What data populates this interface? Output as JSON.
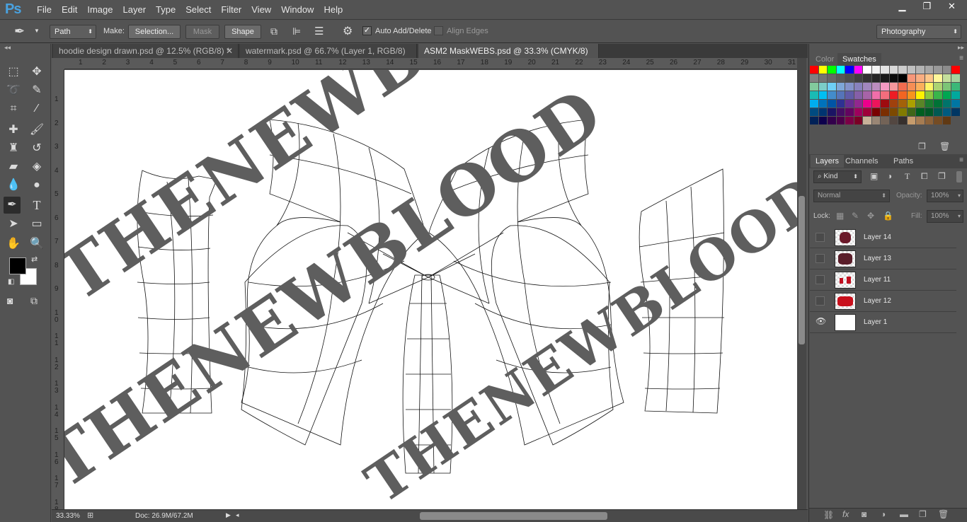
{
  "app": {
    "logo": "Ps",
    "workspace": "Photography",
    "window_buttons": [
      "▁",
      "❐",
      "✕"
    ]
  },
  "menu": [
    "File",
    "Edit",
    "Image",
    "Layer",
    "Type",
    "Select",
    "Filter",
    "View",
    "Window",
    "Help"
  ],
  "options": {
    "mode": "Path",
    "make_label": "Make:",
    "selection_btn": "Selection...",
    "mask_btn": "Mask",
    "shape_btn": "Shape",
    "auto_add_delete": "Auto Add/Delete",
    "auto_add_checked": true,
    "align_edges": "Align Edges"
  },
  "tabs": [
    {
      "label": "hoodie design drawn.psd @ 12.5% (RGB/8) *",
      "active": false
    },
    {
      "label": "watermark.psd @ 66.7% (Layer 1, RGB/8) *",
      "active": false
    },
    {
      "label": "ASM2 MaskWEBS.psd @ 33.3% (CMYK/8) *",
      "active": true
    }
  ],
  "ruler_top": [
    "1",
    "2",
    "3",
    "4",
    "5",
    "6",
    "7",
    "8",
    "9",
    "10",
    "11",
    "12",
    "13",
    "14",
    "15",
    "16",
    "17",
    "18",
    "19",
    "20",
    "21",
    "22",
    "23",
    "24",
    "25",
    "26",
    "27",
    "28",
    "29",
    "30",
    "31"
  ],
  "ruler_left": [
    "1",
    "2",
    "3",
    "4",
    "5",
    "6",
    "7",
    "8",
    "9",
    "1 0",
    "1 1",
    "1 2",
    "1 3",
    "1 4",
    "1 5",
    "1 6",
    "1 7",
    "1 8"
  ],
  "watermark": "THENEWBLOOD",
  "status": {
    "zoom": "33.33%",
    "doc": "Doc: 26.9M/67.2M"
  },
  "panels": {
    "top_tabs": [
      "Color",
      "Swatches"
    ],
    "active_top": "Swatches",
    "layers_tabs": [
      "Layers",
      "Channels",
      "Paths"
    ],
    "filter_kind": "Kind",
    "blend_mode": "Normal",
    "opacity_label": "Opacity:",
    "opacity_value": "100%",
    "lock_label": "Lock:",
    "fill_label": "Fill:",
    "fill_value": "100%"
  },
  "layers": [
    {
      "name": "Layer 14",
      "visible": false,
      "thumb": "spider"
    },
    {
      "name": "Layer 13",
      "visible": false,
      "thumb": "spider"
    },
    {
      "name": "Layer 11",
      "visible": false,
      "thumb": "red-sparse"
    },
    {
      "name": "Layer 12",
      "visible": false,
      "thumb": "red"
    },
    {
      "name": "Layer 1",
      "visible": true,
      "thumb": "white"
    }
  ],
  "swatches": [
    "#ff0000",
    "#ffff00",
    "#00ff00",
    "#00ffff",
    "#0000ff",
    "#ff00ff",
    "#ffffff",
    "#f2f2f2",
    "#e5e5e5",
    "#d9d9d9",
    "#cccccc",
    "#bfbfbf",
    "#b3b3b3",
    "#a6a6a6",
    "#999999",
    "#8c8c8c",
    "#ff0000",
    "#808080",
    "#737373",
    "#666666",
    "#595959",
    "#4d4d4d",
    "#404040",
    "#333333",
    "#262626",
    "#1a1a1a",
    "#0d0d0d",
    "#000000",
    "#f69679",
    "#f9ad81",
    "#fdc68a",
    "#fff79a",
    "#c4df9b",
    "#a3d39c",
    "#82ca9d",
    "#7bcdc8",
    "#6ecff6",
    "#7ea7d8",
    "#8493ca",
    "#8882be",
    "#a187be",
    "#bc8dbf",
    "#f49ac2",
    "#f6989d",
    "#f26c4f",
    "#f68e55",
    "#fbaf5c",
    "#fff467",
    "#acd372",
    "#7cc576",
    "#3bb878",
    "#1abbb4",
    "#00bff3",
    "#438ccb",
    "#5574b9",
    "#605ca8",
    "#855fa8",
    "#a763a8",
    "#f06eaa",
    "#f26d7d",
    "#ed1c24",
    "#f26522",
    "#f7941d",
    "#fff200",
    "#8dc73f",
    "#39b54a",
    "#00a651",
    "#00a99d",
    "#00aeef",
    "#0072bc",
    "#0054a6",
    "#2e3192",
    "#662d91",
    "#92278f",
    "#ec008c",
    "#ed145b",
    "#9e0b0f",
    "#a0410d",
    "#a36209",
    "#aba000",
    "#598527",
    "#1a7b30",
    "#007236",
    "#00746b",
    "#0076a3",
    "#004b80",
    "#003471",
    "#1b1464",
    "#440e62",
    "#630460",
    "#9e005d",
    "#9e0039",
    "#790000",
    "#7b2e00",
    "#7d4900",
    "#827b00",
    "#406618",
    "#005e20",
    "#005826",
    "#005952",
    "#005b7f",
    "#003663",
    "#002157",
    "#0d004c",
    "#32004b",
    "#4b0049",
    "#7b0046",
    "#7a0026",
    "#c7b299",
    "#998675",
    "#736357",
    "#534741",
    "#37302d",
    "#c69c6d",
    "#a67c52",
    "#8c6239",
    "#754c24",
    "#603913"
  ]
}
